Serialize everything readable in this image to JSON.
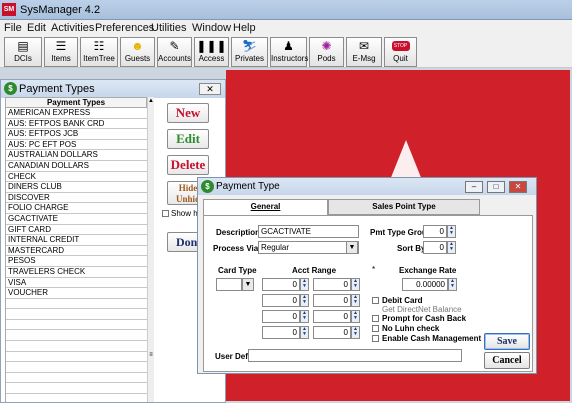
{
  "app": {
    "title": "SysManager 4.2",
    "logo_text": "SM"
  },
  "menu": [
    "File",
    "Edit",
    "Activities",
    "Preferences",
    "Utilities",
    "Window",
    "Help"
  ],
  "toolbar": [
    {
      "label": "DCIs",
      "icon": "dci-icon"
    },
    {
      "label": "Items",
      "icon": "items-icon"
    },
    {
      "label": "ItemTree",
      "icon": "item-tree-icon"
    },
    {
      "label": "Guests",
      "icon": "guests-icon"
    },
    {
      "label": "Accounts",
      "icon": "accounts-icon"
    },
    {
      "label": "Access",
      "icon": "barcode-icon"
    },
    {
      "label": "Privates",
      "icon": "privates-icon"
    },
    {
      "label": "Instructors",
      "icon": "instructor-icon"
    },
    {
      "label": "Pods",
      "icon": "pods-icon"
    },
    {
      "label": "E-Msg",
      "icon": "email-icon"
    },
    {
      "label": "Quit",
      "icon": "stop-icon",
      "icon_text": "STOP"
    }
  ],
  "payment_types_window": {
    "title": "Payment Types",
    "list_header": "Payment Types",
    "items": [
      "AMERICAN EXPRESS",
      "AUS: EFTPOS BANK CRD",
      "AUS: EFTPOS JCB",
      "AUS: PC EFT POS",
      "AUSTRALIAN DOLLARS",
      "CANADIAN DOLLARS",
      "CHECK",
      "DINERS CLUB",
      "DISCOVER",
      "FOLIO CHARGE",
      "GCACTIVATE",
      "GIFT CARD",
      "INTERNAL CREDIT",
      "MASTERCARD",
      "PESOS",
      "TRAVELERS CHECK",
      "VISA",
      "VOUCHER",
      "",
      "",
      "",
      "",
      "",
      "",
      "",
      "",
      ""
    ],
    "buttons": {
      "new": "New",
      "edit": "Edit",
      "delete": "Delete",
      "hide": "Hide Unhid",
      "show": "Show h",
      "done": "Don"
    },
    "button_colors": {
      "new": "#c8102e",
      "edit": "#2e8a2e",
      "delete": "#c8102e"
    }
  },
  "payment_type_dialog": {
    "title": "Payment Type",
    "tabs": [
      "General",
      "Sales Point Type"
    ],
    "description_label": "Description",
    "description_value": "GCACTIVATE",
    "process_via_label": "Process Via",
    "process_via_value": "Regular",
    "pmt_type_group_label": "Pmt Type Group",
    "pmt_type_group_value": "0",
    "sort_by_label": "Sort By",
    "sort_by_value": "0",
    "card_type_label": "Card Type",
    "card_type_value": "",
    "acct_range_label": "Acct Range",
    "asterisk": "*",
    "acct_ranges": [
      [
        "0",
        "0"
      ],
      [
        "0",
        "0"
      ],
      [
        "0",
        "0"
      ],
      [
        "0",
        "0"
      ]
    ],
    "exchange_rate_label": "Exchange Rate",
    "exchange_rate_value": "0.00000",
    "checkboxes": [
      {
        "label": "Debit Card",
        "enabled": true
      },
      {
        "label": "Get DirectNet Balance",
        "enabled": false
      },
      {
        "label": "Prompt for Cash Back",
        "enabled": true
      },
      {
        "label": "No Luhn check",
        "enabled": true
      },
      {
        "label": "Enable Cash Management",
        "enabled": true
      }
    ],
    "user_def_label": "User Def",
    "user_def_value": "",
    "save_label": "Save",
    "cancel_label": "Cancel"
  }
}
